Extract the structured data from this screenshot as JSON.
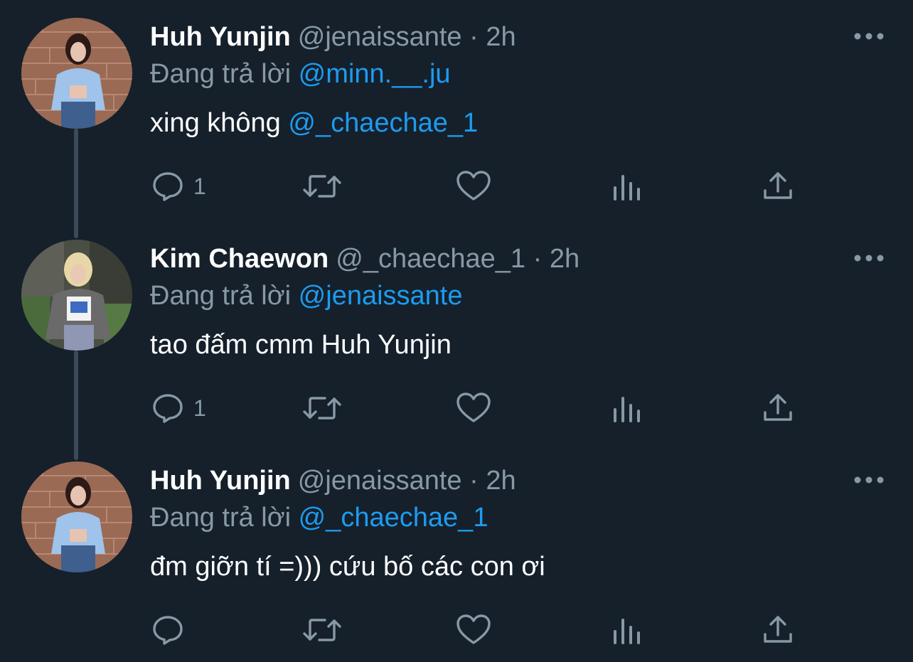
{
  "theme": {
    "background": "#15202b",
    "text_primary": "#ffffff",
    "text_secondary": "#8899a6",
    "link": "#1d9bf0",
    "thread_line": "#3d4a57"
  },
  "tweets": [
    {
      "name": "Huh Yunjin",
      "handle": "@jenaissante",
      "separator": "·",
      "time": "2h",
      "reply_label": "Đang trả lời",
      "reply_to": "@minn.__.ju",
      "text_plain": "xing không ",
      "text_mention": "@_chaechae_1",
      "reply_count": "1",
      "avatar_icon": "avatar-huh-yunjin"
    },
    {
      "name": "Kim Chaewon",
      "handle": "@_chaechae_1",
      "separator": "·",
      "time": "2h",
      "reply_label": "Đang trả lời",
      "reply_to": "@jenaissante",
      "text_plain": "tao đấm cmm Huh Yunjin",
      "text_mention": "",
      "reply_count": "1",
      "avatar_icon": "avatar-kim-chaewon"
    },
    {
      "name": "Huh Yunjin",
      "handle": "@jenaissante",
      "separator": "·",
      "time": "2h",
      "reply_label": "Đang trả lời",
      "reply_to": "@_chaechae_1",
      "text_plain": "đm giỡn tí =))) cứu bố các con ơi",
      "text_mention": "",
      "reply_count": "",
      "avatar_icon": "avatar-huh-yunjin"
    }
  ],
  "icons": {
    "reply": "reply-icon",
    "retweet": "retweet-icon",
    "like": "heart-icon",
    "views": "views-icon",
    "share": "share-icon",
    "more": "more-icon"
  }
}
